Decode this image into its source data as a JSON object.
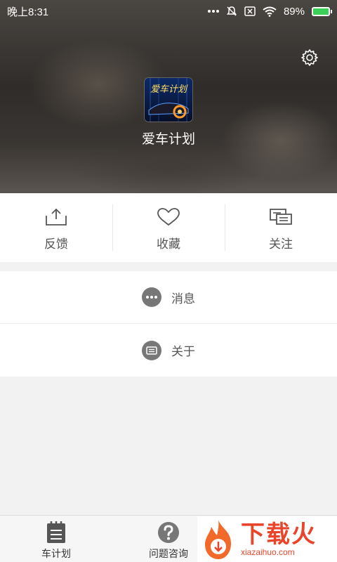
{
  "status_bar": {
    "time": "晚上8:31",
    "battery": "89%"
  },
  "profile": {
    "app_name": "爱车计划",
    "logo_text": "爱车计划"
  },
  "actions": [
    {
      "label": "反馈",
      "icon": "share-upload-icon"
    },
    {
      "label": "收藏",
      "icon": "heart-icon"
    },
    {
      "label": "关注",
      "icon": "cards-icon"
    }
  ],
  "menu": [
    {
      "label": "消息",
      "icon": "chat-dots-icon"
    },
    {
      "label": "关于",
      "icon": "info-card-icon"
    }
  ],
  "tabs": [
    {
      "label": "车计划",
      "icon": "notepad-icon"
    },
    {
      "label": "问题咨询",
      "icon": "question-icon"
    }
  ],
  "watermark": {
    "main": "下载火",
    "sub": "xiazaihuo.com"
  },
  "colors": {
    "accent": "#e9452a",
    "battery": "#3ccf5a"
  }
}
